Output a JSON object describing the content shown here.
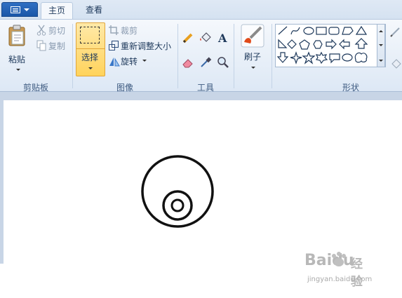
{
  "tabs": {
    "home": "主页",
    "view": "查看"
  },
  "clipboard": {
    "paste": "粘贴",
    "cut": "剪切",
    "copy": "复制",
    "group": "剪贴板"
  },
  "image": {
    "select": "选择",
    "crop": "裁剪",
    "resize": "重新调整大小",
    "rotate": "旋转",
    "group": "图像"
  },
  "tools": {
    "group": "工具"
  },
  "brushes": {
    "label": "刷子"
  },
  "shapes": {
    "group": "形状"
  },
  "watermark": {
    "brand": "Baidu",
    "product": "经验",
    "url": "jingyan.baidu.com"
  }
}
